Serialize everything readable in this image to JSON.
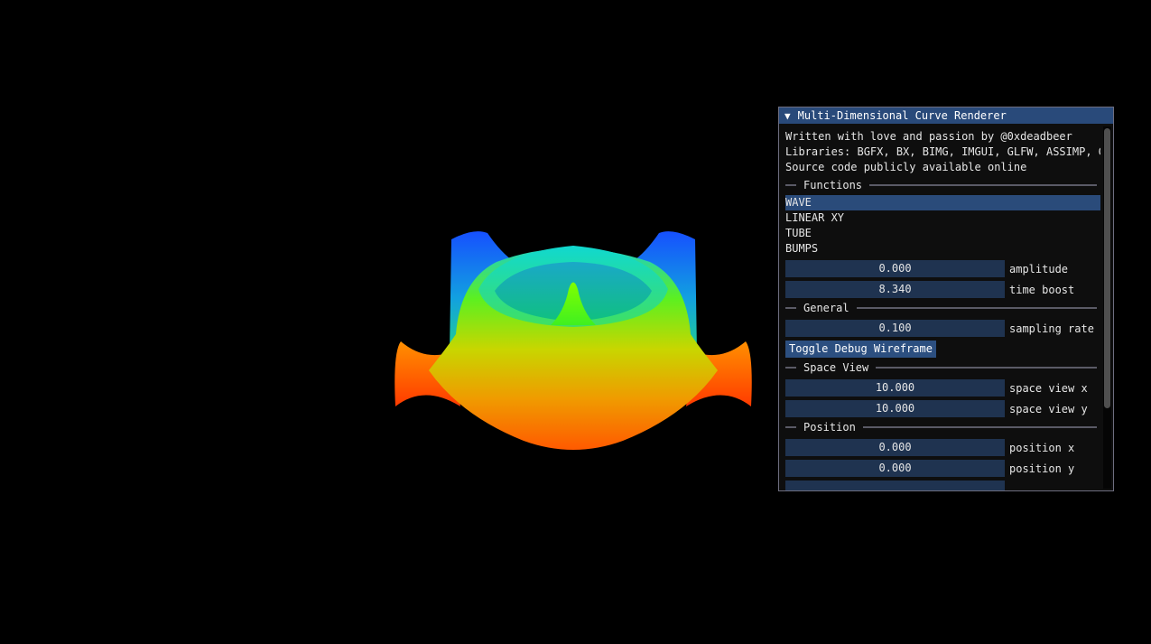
{
  "window": {
    "title": "Multi-Dimensional Curve Renderer",
    "collapse_arrow": "▼"
  },
  "info": {
    "line1": "Written with love and passion by @0xdeadbeer",
    "line2": "Libraries: BGFX, BX, BIMG, IMGUI, GLFW, ASSIMP, GLM",
    "line3": "Source code publicly available online"
  },
  "functions": {
    "header": "Functions",
    "items": [
      "WAVE",
      "LINEAR XY",
      "TUBE",
      "BUMPS"
    ],
    "selected": "WAVE",
    "amplitude": {
      "value": "0.000",
      "label": "amplitude"
    },
    "time_boost": {
      "value": "8.340",
      "label": "time boost"
    }
  },
  "general": {
    "header": "General",
    "sampling_rate": {
      "value": "0.100",
      "label": "sampling rate"
    },
    "toggle_button": "Toggle Debug Wireframe"
  },
  "space_view": {
    "header": "Space View",
    "x": {
      "value": "10.000",
      "label": "space view x"
    },
    "y": {
      "value": "10.000",
      "label": "space view y"
    }
  },
  "position": {
    "header": "Position",
    "x": {
      "value": "0.000",
      "label": "position x"
    },
    "y": {
      "value": "0.000",
      "label": "position y"
    }
  },
  "colors": {
    "title_bar": "#294a7a",
    "frame_bg": "#1f3350",
    "selected_bg": "#2a4b7a",
    "button": "#2c4f80",
    "surface_low": "#ff4a00",
    "surface_mid": "#7dff00",
    "surface_high": "#0050ff"
  }
}
